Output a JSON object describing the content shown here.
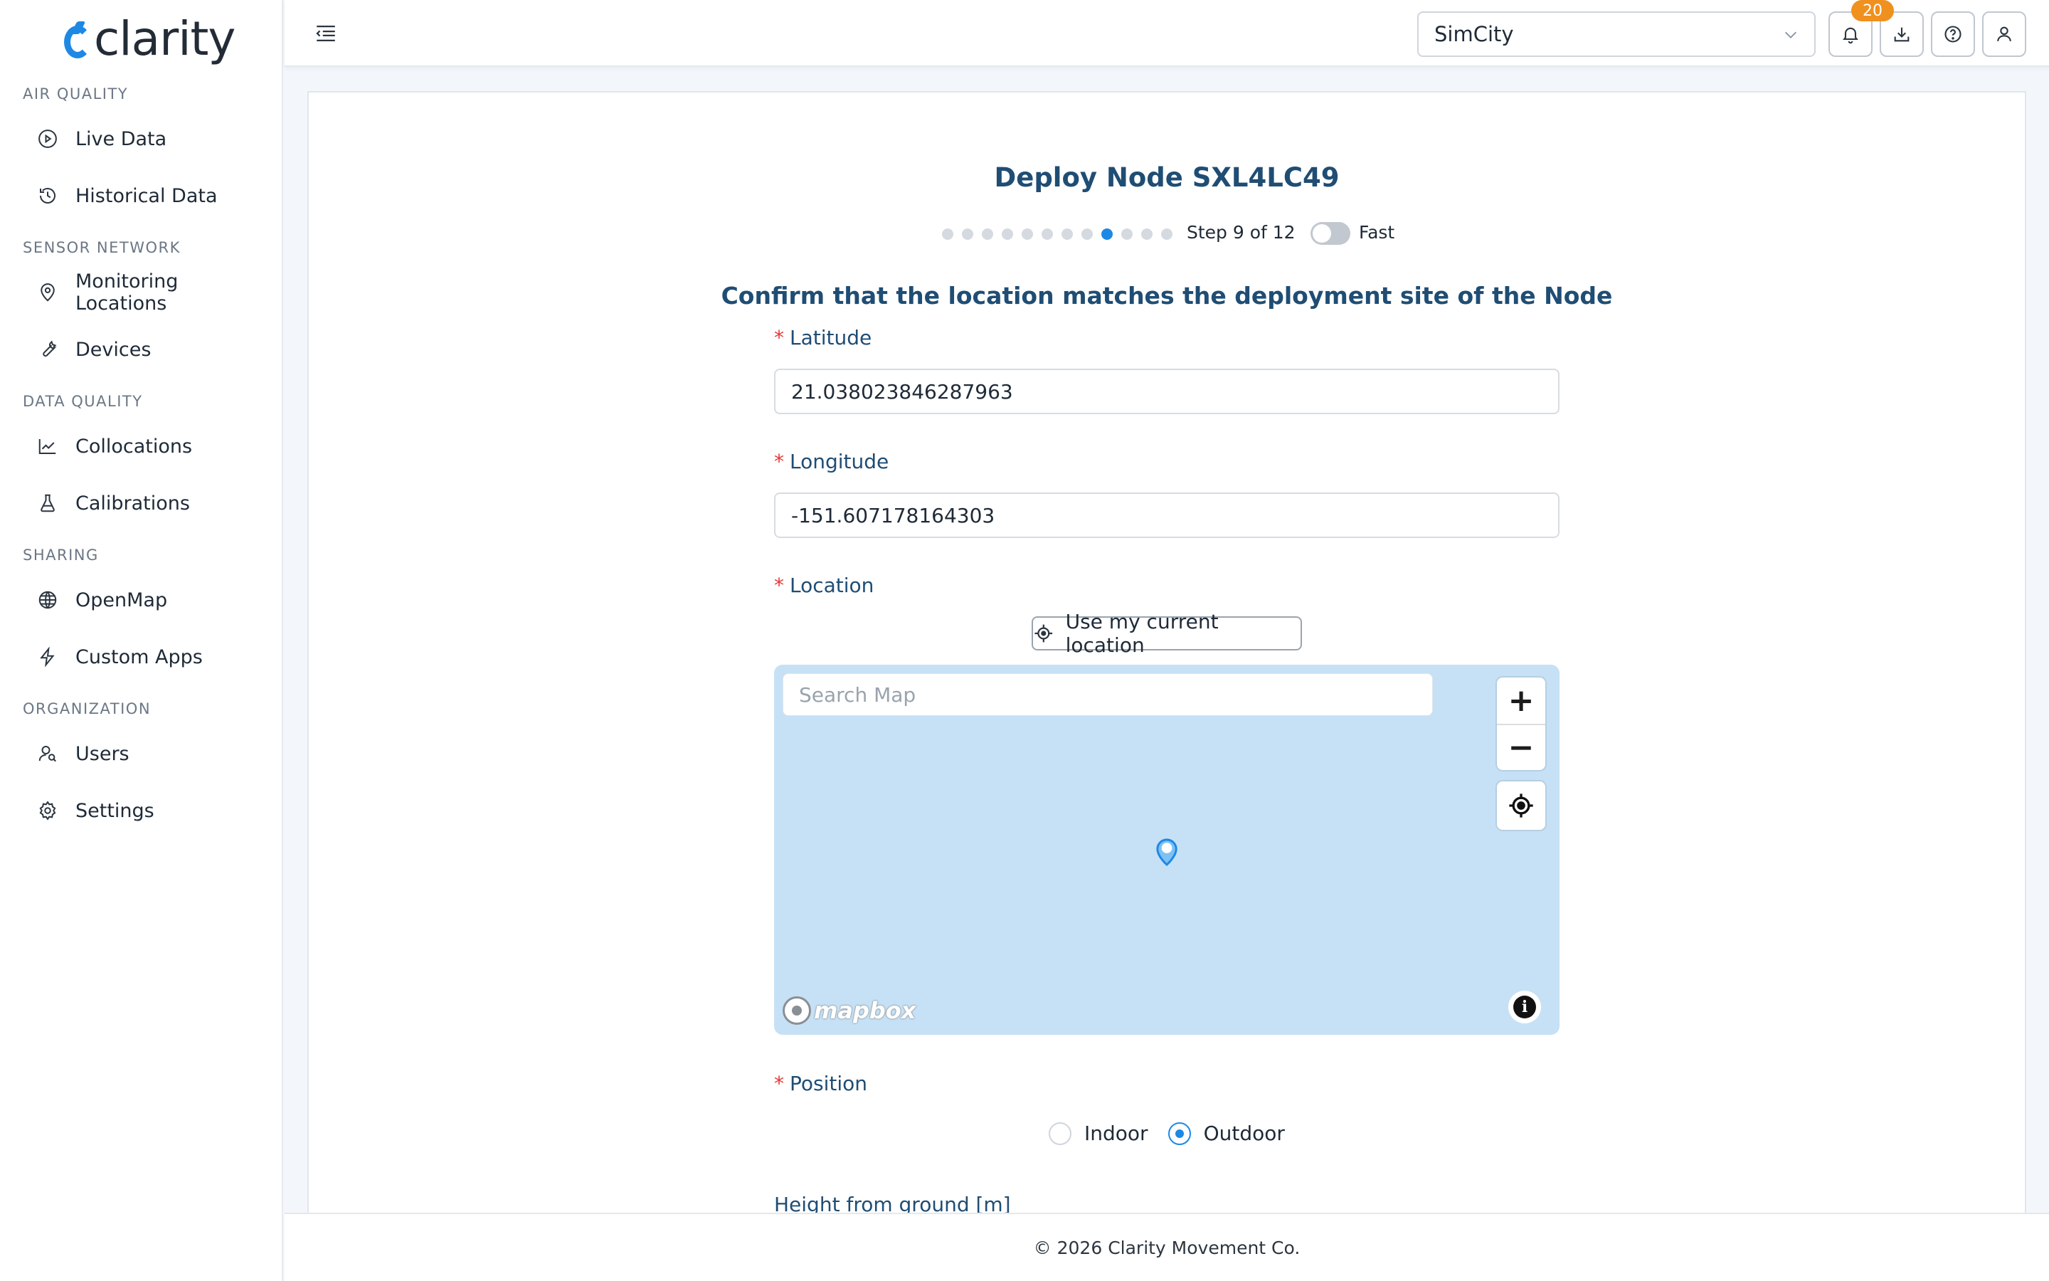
{
  "brand": {
    "name": "clarity",
    "accent": "#1e88e5"
  },
  "sidebar": {
    "sections": [
      {
        "title": "AIR QUALITY",
        "items": [
          {
            "label": "Live Data",
            "icon": "play-circle-icon"
          },
          {
            "label": "Historical Data",
            "icon": "history-icon"
          }
        ]
      },
      {
        "title": "SENSOR NETWORK",
        "items": [
          {
            "label": "Monitoring Locations",
            "icon": "location-pin-icon"
          },
          {
            "label": "Devices",
            "icon": "wrench-icon"
          }
        ]
      },
      {
        "title": "DATA QUALITY",
        "items": [
          {
            "label": "Collocations",
            "icon": "line-chart-icon"
          },
          {
            "label": "Calibrations",
            "icon": "flask-icon"
          }
        ]
      },
      {
        "title": "SHARING",
        "items": [
          {
            "label": "OpenMap",
            "icon": "globe-icon"
          },
          {
            "label": "Custom Apps",
            "icon": "lightning-icon"
          }
        ]
      },
      {
        "title": "ORGANIZATION",
        "items": [
          {
            "label": "Users",
            "icon": "users-icon"
          },
          {
            "label": "Settings",
            "icon": "gear-icon"
          }
        ]
      }
    ]
  },
  "header": {
    "org_select": {
      "value": "SimCity"
    },
    "notifications_count": "20"
  },
  "wizard": {
    "title": "Deploy Node SXL4LC49",
    "step_text": "Step 9 of 12",
    "current_step": 9,
    "total_steps": 12,
    "fast_label": "Fast",
    "fast_enabled": false,
    "subtitle": "Confirm that the location matches the deployment site of the Node",
    "latitude": {
      "label": "Latitude",
      "value": "21.038023846287963"
    },
    "longitude": {
      "label": "Longitude",
      "value": "-151.607178164303"
    },
    "location": {
      "label": "Location",
      "use_current_label": "Use my current location"
    },
    "map": {
      "search_placeholder": "Search Map",
      "attribution": "mapbox",
      "zoom_in": "+",
      "zoom_out": "−",
      "background": "#c6e1f5"
    },
    "position": {
      "label": "Position",
      "options": [
        "Indoor",
        "Outdoor"
      ],
      "selected": "Outdoor"
    },
    "height": {
      "label": "Height from ground [m]"
    }
  },
  "footer": {
    "text": "© 2026 Clarity Movement Co."
  }
}
